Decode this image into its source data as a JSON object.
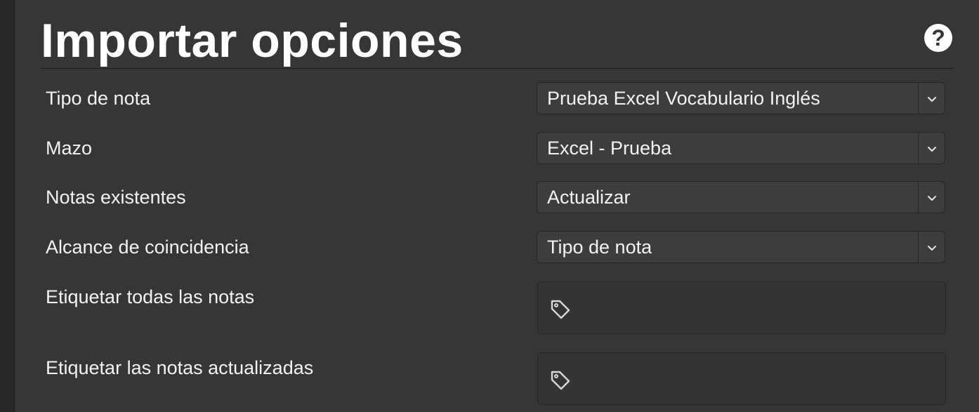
{
  "dialog": {
    "title": "Importar opciones",
    "help_icon": "?"
  },
  "fields": [
    {
      "label": "Tipo de nota",
      "value": "Prueba Excel Vocabulario Inglés",
      "icon": "chevron-down-icon"
    },
    {
      "label": "Mazo",
      "value": "Excel - Prueba",
      "icon": "chevron-down-icon"
    },
    {
      "label": "Notas existentes",
      "value": "Actualizar",
      "icon": "chevron-down-icon"
    },
    {
      "label": "Alcance de coincidencia",
      "value": "Tipo de nota",
      "icon": "chevron-down-icon"
    }
  ],
  "tag_fields": [
    {
      "label": "Etiquetar todas las notas",
      "value": "",
      "icon": "tag-icon"
    },
    {
      "label": "Etiquetar las notas actualizadas",
      "value": "",
      "icon": "tag-icon"
    }
  ],
  "colors": {
    "background": "#363636",
    "text": "#f2f2f2",
    "control": "#3d3d3d"
  }
}
